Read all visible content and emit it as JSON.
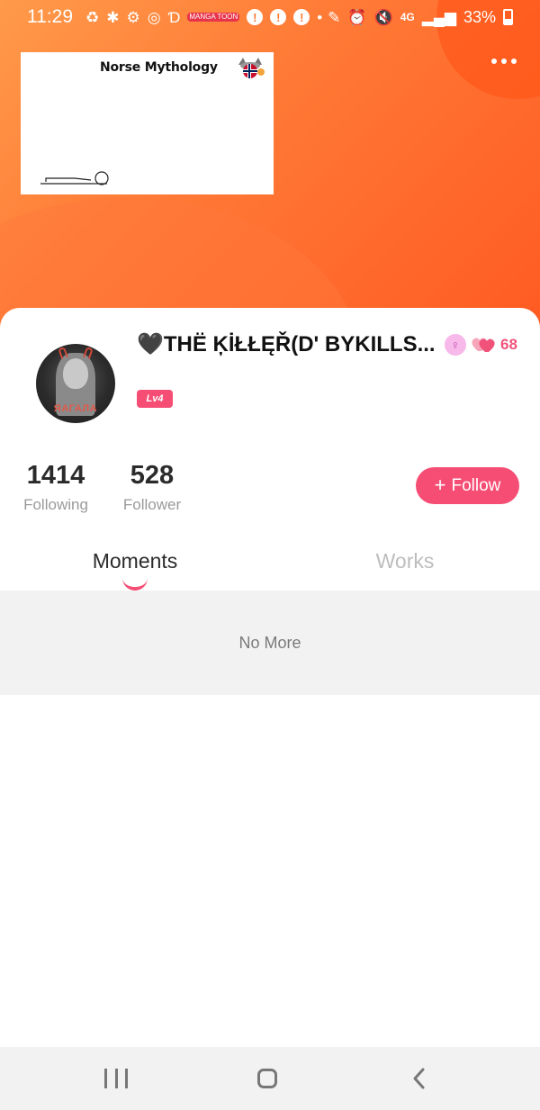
{
  "status_bar": {
    "time": "11:29",
    "network": "4G",
    "battery": "33%",
    "alerts": [
      "!",
      "!",
      "!"
    ],
    "misc_badge": "MANGA TOON"
  },
  "banner": {
    "title": "Norse Mythology"
  },
  "profile": {
    "username": "🖤THË ĶİŁŁĘŘ(D' BYKILLS...",
    "gender_symbol": "♀",
    "likes": "68",
    "level": "Lv4",
    "avatar_caption": "ЯАГАЛА"
  },
  "stats": {
    "following_count": "1414",
    "following_label": "Following",
    "follower_count": "528",
    "follower_label": "Follower"
  },
  "actions": {
    "follow_label": "Follow",
    "follow_icon": "+"
  },
  "tabs": {
    "moments": "Moments",
    "works": "Works"
  },
  "feed": {
    "empty_text": "No More"
  },
  "colors": {
    "accent": "#f54d74",
    "header_start": "#ff9a4a",
    "header_end": "#ff5a22"
  }
}
